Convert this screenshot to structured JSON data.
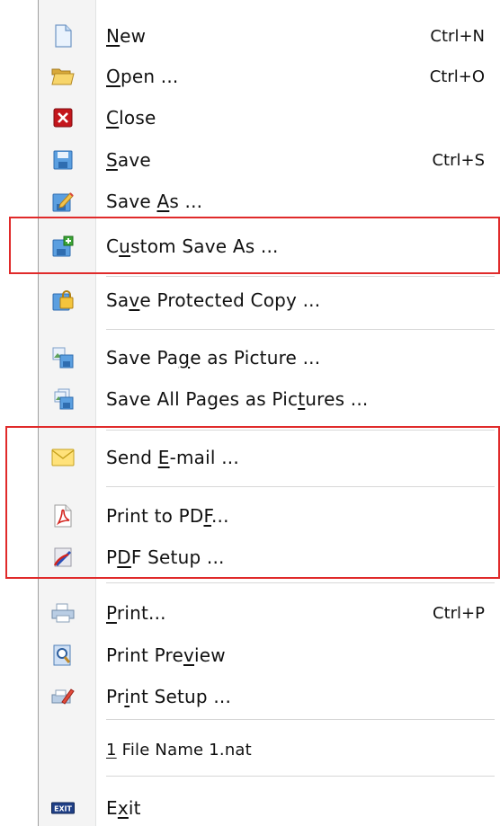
{
  "menu": {
    "new": {
      "pre": "",
      "ul": "N",
      "post": "ew",
      "shortcut": "Ctrl+N",
      "icon": "new-document-icon"
    },
    "open": {
      "pre": "",
      "ul": "O",
      "post": "pen ...",
      "shortcut": "Ctrl+O",
      "icon": "open-folder-icon"
    },
    "close": {
      "pre": "",
      "ul": "C",
      "post": "lose",
      "icon": "close-red-x-icon"
    },
    "save": {
      "pre": "",
      "ul": "S",
      "post": "ave",
      "shortcut": "Ctrl+S",
      "icon": "save-floppy-icon"
    },
    "save_as": {
      "pre": "Save ",
      "ul": "A",
      "post": "s ...",
      "icon": "save-as-pencil-icon"
    },
    "custom_save_as": {
      "pre": "C",
      "ul": "u",
      "post": "stom Save As ...",
      "icon": "custom-save-plus-icon"
    },
    "save_protected": {
      "pre": "Sa",
      "ul": "v",
      "post": "e Protected Copy ...",
      "icon": "protected-copy-lock-icon"
    },
    "save_page_picture": {
      "pre": "Save Pa",
      "ul": "g",
      "post": "e as Picture ...",
      "icon": "page-picture-icon"
    },
    "save_all_pictures": {
      "pre": "Save All Pages as Pic",
      "ul": "t",
      "post": "ures ...",
      "icon": "all-pages-pictures-icon"
    },
    "send_email": {
      "pre": "Send ",
      "ul": "E",
      "post": "-mail ...",
      "icon": "email-envelope-icon"
    },
    "print_pdf": {
      "pre": "Print to PD",
      "ul": "F",
      "post": "...",
      "icon": "pdf-document-icon"
    },
    "pdf_setup": {
      "pre": "P",
      "ul": "D",
      "post": "F Setup ...",
      "icon": "pdf-setup-icon"
    },
    "print": {
      "pre": "",
      "ul": "P",
      "post": "rint...",
      "shortcut": "Ctrl+P",
      "icon": "printer-icon"
    },
    "print_preview": {
      "pre": "Print Pre",
      "ul": "v",
      "post": "iew",
      "icon": "print-preview-magnifier-icon"
    },
    "print_setup": {
      "pre": "Pr",
      "ul": "i",
      "post": "nt Setup ...",
      "icon": "print-setup-icon"
    },
    "recent_file": {
      "pre": "",
      "ul": "1",
      "post": " File Name 1.nat"
    },
    "exit": {
      "pre": "E",
      "ul": "x",
      "post": "it",
      "icon": "exit-icon",
      "badge": "EXIT"
    }
  },
  "colors": {
    "highlight": "#e02a2a",
    "separator": "#d7d7d7",
    "gutter": "#f4f4f4"
  }
}
